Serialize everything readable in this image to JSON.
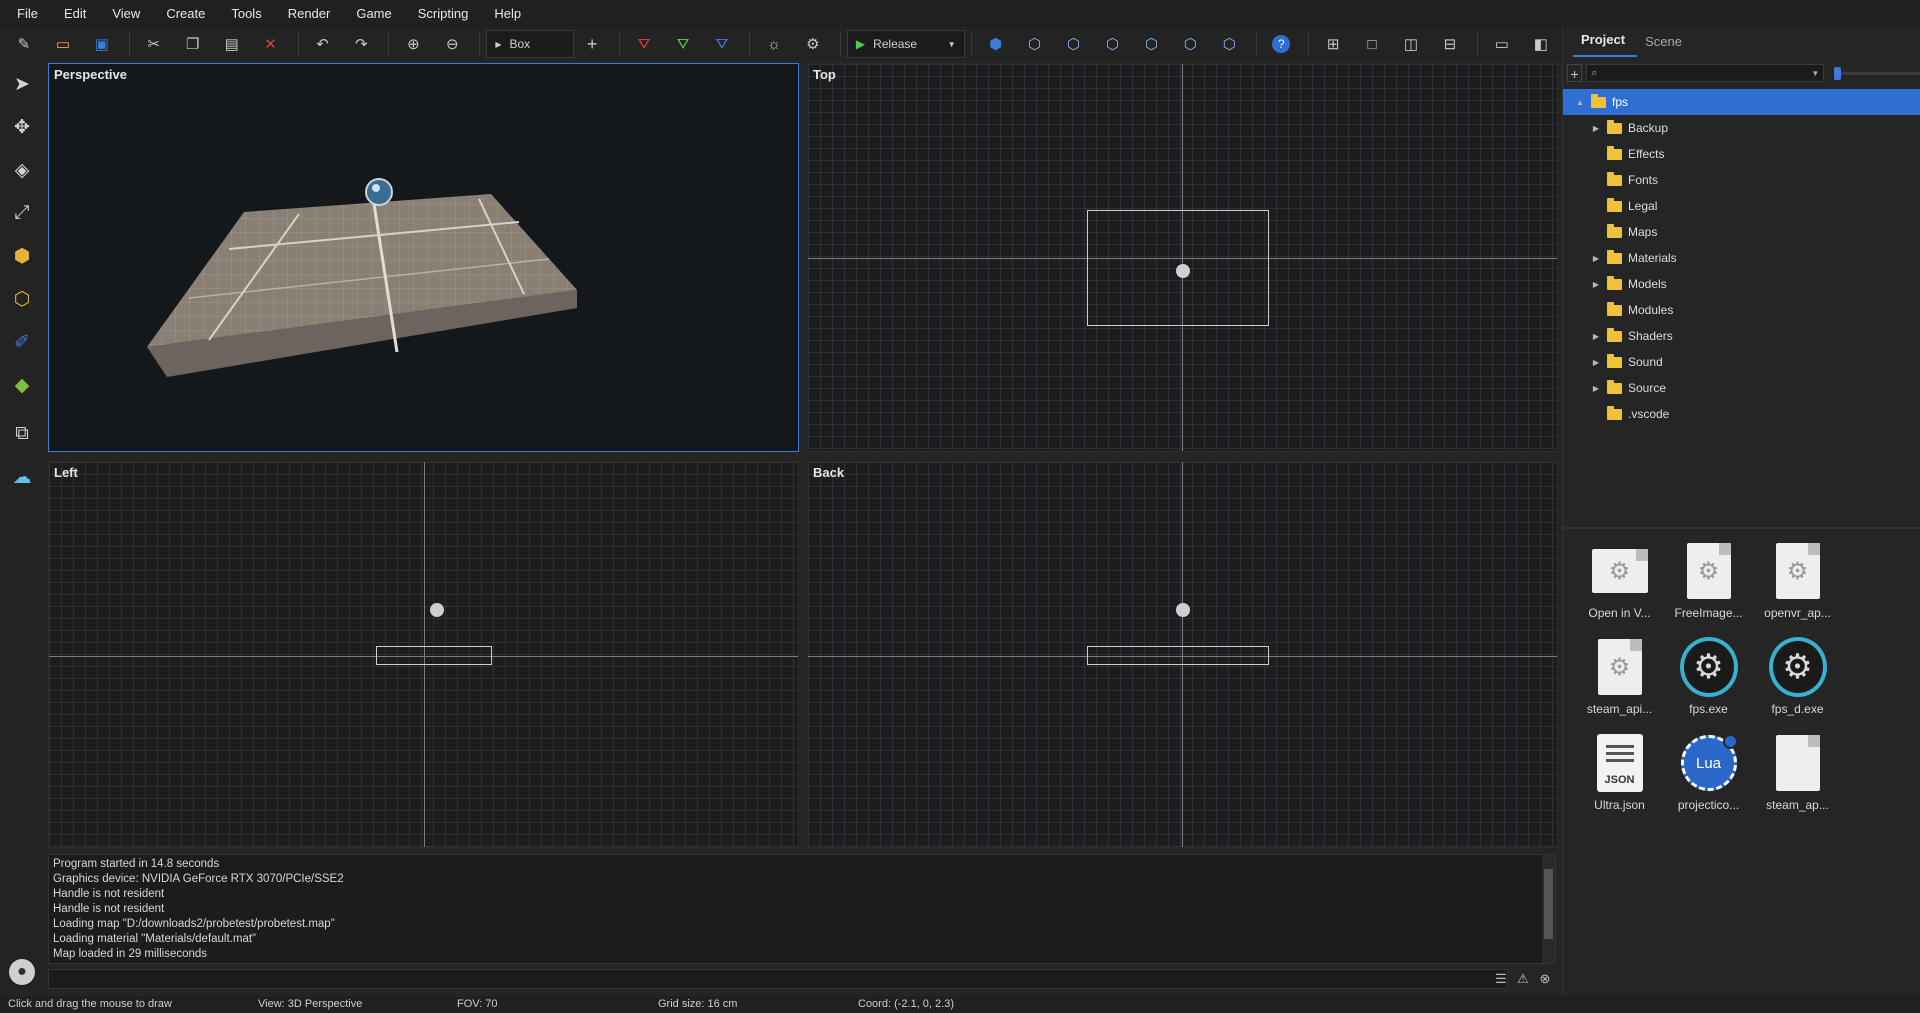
{
  "menu": [
    "File",
    "Edit",
    "View",
    "Create",
    "Tools",
    "Render",
    "Game",
    "Scripting",
    "Help"
  ],
  "toolbar": {
    "primitive": "Box",
    "build_config": "Release",
    "colors": {
      "accent": "#3d7bd9",
      "play": "#52c64e",
      "error": "#e03a3a"
    }
  },
  "viewports": {
    "perspective": "Perspective",
    "top": "Top",
    "left": "Left",
    "back": "Back"
  },
  "panel": {
    "tabs": [
      "Project",
      "Scene"
    ],
    "search_placeholder": "⌕",
    "tree_root": "fps",
    "tree": [
      {
        "label": "Backup",
        "expandable": true
      },
      {
        "label": "Effects",
        "expandable": false
      },
      {
        "label": "Fonts",
        "expandable": false
      },
      {
        "label": "Legal",
        "expandable": false
      },
      {
        "label": "Maps",
        "expandable": false
      },
      {
        "label": "Materials",
        "expandable": true
      },
      {
        "label": "Models",
        "expandable": true
      },
      {
        "label": "Modules",
        "expandable": false
      },
      {
        "label": "Shaders",
        "expandable": true
      },
      {
        "label": "Sound",
        "expandable": true
      },
      {
        "label": "Source",
        "expandable": true
      },
      {
        "label": ".vscode",
        "expandable": false
      }
    ],
    "files": [
      {
        "label": "Open in V...",
        "icon": "shortcut-gear-icon"
      },
      {
        "label": "FreeImage...",
        "icon": "dll-gear-icon"
      },
      {
        "label": "openvr_ap...",
        "icon": "dll-gear-icon"
      },
      {
        "label": "steam_api...",
        "icon": "dll-gear-icon"
      },
      {
        "label": "fps.exe",
        "icon": "exe-icon"
      },
      {
        "label": "fps_d.exe",
        "icon": "exe-icon"
      },
      {
        "label": "Ultra.json",
        "icon": "json-icon"
      },
      {
        "label": "projectico...",
        "icon": "lua-icon"
      },
      {
        "label": "steam_ap...",
        "icon": "blank-doc-icon"
      }
    ]
  },
  "console": {
    "lines": [
      "Program started in 14.8 seconds",
      "Graphics device: NVIDIA GeForce RTX 3070/PCIe/SSE2",
      "Handle is not resident",
      "Handle is not resident",
      "Loading map \"D:/downloads2/probetest/probetest.map\"",
      "Loading material \"Materials/default.mat\"",
      "Map loaded in 29 milliseconds"
    ]
  },
  "status": {
    "hint": "Click and drag the mouse to draw",
    "view": "View: 3D Perspective",
    "fov": "FOV: 70",
    "grid": "Grid size: 16 cm",
    "coord": "Coord: (-2.1, 0, 2.3)"
  }
}
